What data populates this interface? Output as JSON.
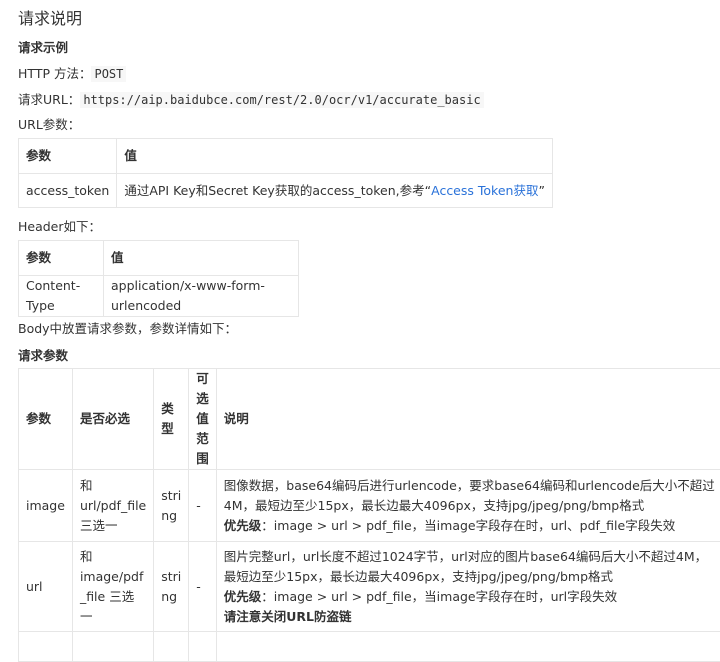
{
  "title": "请求说明",
  "example_heading": "请求示例",
  "http_method": {
    "label": "HTTP 方法：",
    "value": "POST"
  },
  "request_url": {
    "label": "请求URL：",
    "value": "https://aip.baidubce.com/rest/2.0/ocr/v1/accurate_basic"
  },
  "url_params_label": "URL参数：",
  "url_table": {
    "headers": [
      "参数",
      "值"
    ],
    "row": {
      "param": "access_token",
      "value_prefix": "通过API Key和Secret Key获取的access_token,参考“",
      "link": "Access Token获取",
      "value_suffix": "”"
    }
  },
  "header_label": "Header如下：",
  "header_table": {
    "headers": [
      "参数",
      "值"
    ],
    "row": {
      "param": "Content-Type",
      "value": "application/x-www-form-urlencoded"
    }
  },
  "body_label": "Body中放置请求参数，参数详情如下：",
  "params_heading": "请求参数",
  "params_table": {
    "headers": {
      "param": "参数",
      "required": "是否必选",
      "type_line1": "类",
      "type_line2": "型",
      "range_line1": "可选值",
      "range_line2": "范围",
      "desc": "说明"
    },
    "rows": [
      {
        "param": "image",
        "required_line1": "和 url/pdf_file",
        "required_line2": "三选一",
        "type_line1": "stri",
        "type_line2": "ng",
        "range": "-",
        "desc_line1": "图像数据，base64编码后进行urlencode，要求base64编码和urlencode后大小不超过",
        "desc_line2": "4M，最短边至少15px，最长边最大4096px，支持jpg/jpeg/png/bmp格式",
        "priority_label": "优先级",
        "priority_text": "：image > url > pdf_file，当image字段存在时，url、pdf_file字段失效"
      },
      {
        "param": "url",
        "required_line1": "和 image/pdf",
        "required_line2": "_file 三选一",
        "type_line1": "stri",
        "type_line2": "ng",
        "range": "-",
        "desc_line1": "图片完整url，url长度不超过1024字节，url对应的图片base64编码后大小不超过4M，",
        "desc_line2": "最短边至少15px，最长边最大4096px，支持jpg/jpeg/png/bmp格式",
        "priority_label": "优先级",
        "priority_text": "：image > url > pdf_file，当image字段存在时，url字段失效",
        "note": "请注意关闭URL防盗链"
      }
    ]
  }
}
